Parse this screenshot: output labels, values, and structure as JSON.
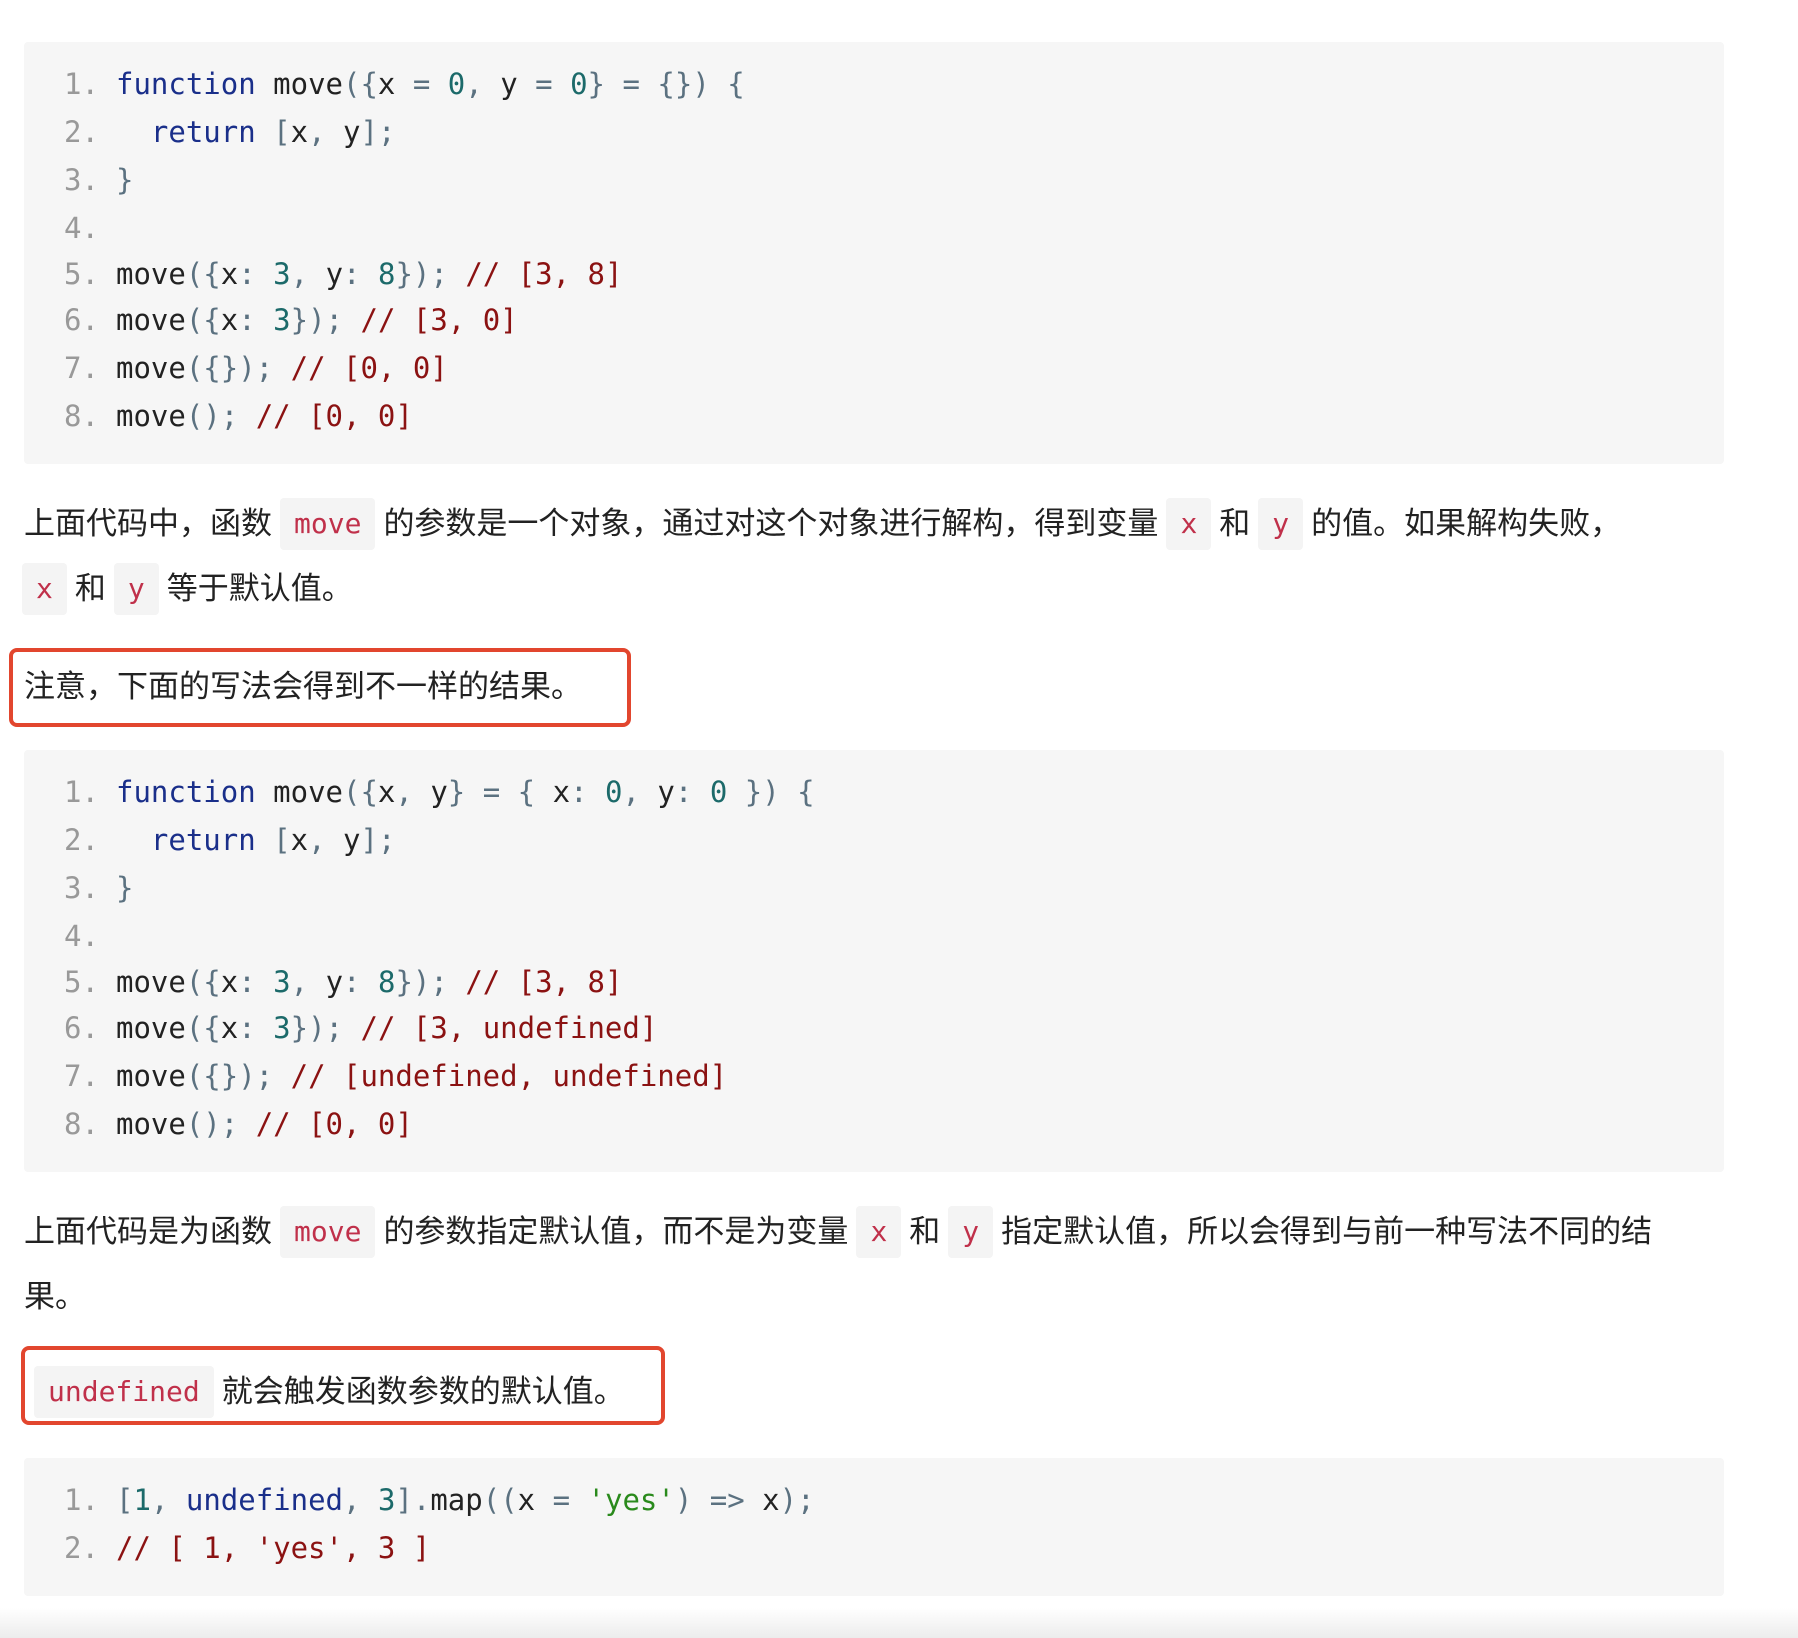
{
  "code_block_1": {
    "line_numbers": [
      "1.",
      "2.",
      "3.",
      "4.",
      "5.",
      "6.",
      "7.",
      "8."
    ],
    "line1": [
      "function",
      "move",
      "({",
      "x",
      "=",
      "0",
      ",",
      "y",
      "=",
      "0",
      "}",
      "=",
      "{})",
      "{"
    ],
    "line2": [
      "return",
      "[",
      "x",
      ",",
      "y",
      "];"
    ],
    "line3": [
      "}"
    ],
    "line5": [
      "move",
      "({",
      "x",
      ":",
      "3",
      ",",
      "y",
      ":",
      "8",
      "});",
      "// [3, 8]"
    ],
    "line6": [
      "move",
      "({",
      "x",
      ":",
      "3",
      "});",
      "// [3, 0]"
    ],
    "line7": [
      "move",
      "({});",
      "// [0, 0]"
    ],
    "line8": [
      "move",
      "();",
      "// [0, 0]"
    ]
  },
  "paragraph_1": {
    "line1": {
      "t1": "上面代码中，函数",
      "move": "move",
      "t2": "的参数是一个对象，通过对这个对象进行解构，得到变量",
      "x": "x",
      "and": "和",
      "y": "y",
      "t3": "的值。如果解构失败，"
    },
    "line2": {
      "x": "x",
      "and": "和",
      "y": "y",
      "t1": "等于默认值。"
    }
  },
  "note_1": "注意，下面的写法会得到不一样的结果。",
  "code_block_2": {
    "line_numbers": [
      "1.",
      "2.",
      "3.",
      "4.",
      "5.",
      "6.",
      "7.",
      "8."
    ],
    "line1": [
      "function",
      "move",
      "({",
      "x",
      ",",
      "y",
      "}",
      "=",
      "{",
      "x",
      ":",
      "0",
      ",",
      "y",
      ":",
      "0",
      "})",
      "{"
    ],
    "line2": [
      "return",
      "[",
      "x",
      ",",
      "y",
      "];"
    ],
    "line3": [
      "}"
    ],
    "line5": [
      "move",
      "({",
      "x",
      ":",
      "3",
      ",",
      "y",
      ":",
      "8",
      "});",
      "// [3, 8]"
    ],
    "line6": [
      "move",
      "({",
      "x",
      ":",
      "3",
      "});",
      "// [3, undefined]"
    ],
    "line7": [
      "move",
      "({});",
      "// [undefined, undefined]"
    ],
    "line8": [
      "move",
      "();",
      "// [0, 0]"
    ]
  },
  "paragraph_2": {
    "line1": {
      "t1": "上面代码是为函数",
      "move": "move",
      "t2": "的参数指定默认值，而不是为变量",
      "x": "x",
      "and": "和",
      "y": "y",
      "t3": "指定默认值，所以会得到与前一种写法不同的结"
    },
    "line2": "果。"
  },
  "note_2": {
    "code": "undefined",
    "text": "就会触发函数参数的默认值。"
  },
  "code_block_3": {
    "line_numbers": [
      "1.",
      "2."
    ],
    "line1": [
      "[",
      "1",
      ",",
      "undefined",
      ",",
      "3",
      "].",
      "map",
      "((",
      "x",
      "=",
      "'yes'",
      ")",
      "=>",
      "x",
      ");"
    ],
    "line2": [
      "// [ 1, 'yes', 3 ]"
    ]
  },
  "colors": {
    "highlight_border": "#e2462e",
    "code_background": "#f6f6f6",
    "inline_code_text": "#c0304a"
  }
}
